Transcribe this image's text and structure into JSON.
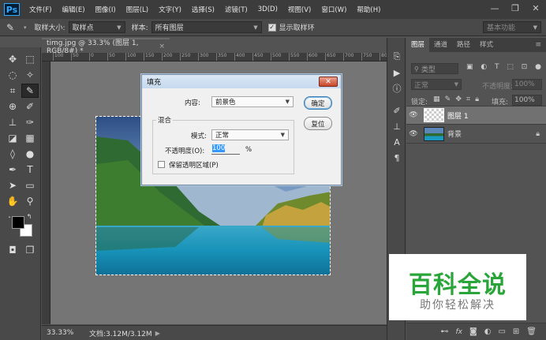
{
  "app": {
    "logo": "Ps"
  },
  "menu": [
    "文件(F)",
    "编辑(E)",
    "图像(I)",
    "图层(L)",
    "文字(Y)",
    "选择(S)",
    "滤镜(T)",
    "3D(D)",
    "视图(V)",
    "窗口(W)",
    "帮助(H)"
  ],
  "window_controls": {
    "minimize": "—",
    "restore": "❐",
    "close": "✕"
  },
  "options_bar": {
    "sample_size_label": "取样大小:",
    "sample_size_value": "取样点",
    "sample_label": "样本:",
    "sample_value": "所有图层",
    "show_ring_label": "显示取样环",
    "workspace": "基本功能"
  },
  "document": {
    "tab_title": "timg.jpg @ 33.3% (图层 1, RGB/8#) *",
    "tab_close": "×",
    "zoom": "33.33%",
    "doc_info": "文档:3.12M/3.12M"
  },
  "ruler_ticks": [
    "100",
    "50",
    "0",
    "50",
    "100",
    "150",
    "200",
    "250",
    "300",
    "350",
    "400",
    "450",
    "500",
    "550",
    "600",
    "650",
    "700",
    "750",
    "800"
  ],
  "fill_dialog": {
    "title": "填充",
    "close": "✕",
    "content_label": "内容:",
    "content_value": "前景色",
    "ok": "确定",
    "reset": "复位",
    "blend_group": "混合",
    "mode_label": "模式:",
    "mode_value": "正常",
    "opacity_label": "不透明度(O):",
    "opacity_value": "100",
    "opacity_unit": "%",
    "preserve_label": "保留透明区域(P)"
  },
  "layers_panel": {
    "tabs": [
      "图层",
      "通道",
      "路径",
      "样式"
    ],
    "filter_kind": "类型",
    "blend_mode": "正常",
    "opacity_label": "不透明度:",
    "opacity_value": "100%",
    "lock_label": "锁定:",
    "fill_label": "填充:",
    "fill_value": "100%",
    "layers": [
      {
        "name": "图层 1",
        "selected": true
      },
      {
        "name": "背景",
        "selected": false,
        "locked": true
      }
    ],
    "footer_icons": [
      "link-icon",
      "fx-icon",
      "mask-icon",
      "adjustment-icon",
      "group-icon",
      "new-layer-icon",
      "trash-icon"
    ]
  },
  "watermark": {
    "title": "百科全说",
    "subtitle": "助你轻松解决",
    "title_color": "#2aa53a"
  }
}
